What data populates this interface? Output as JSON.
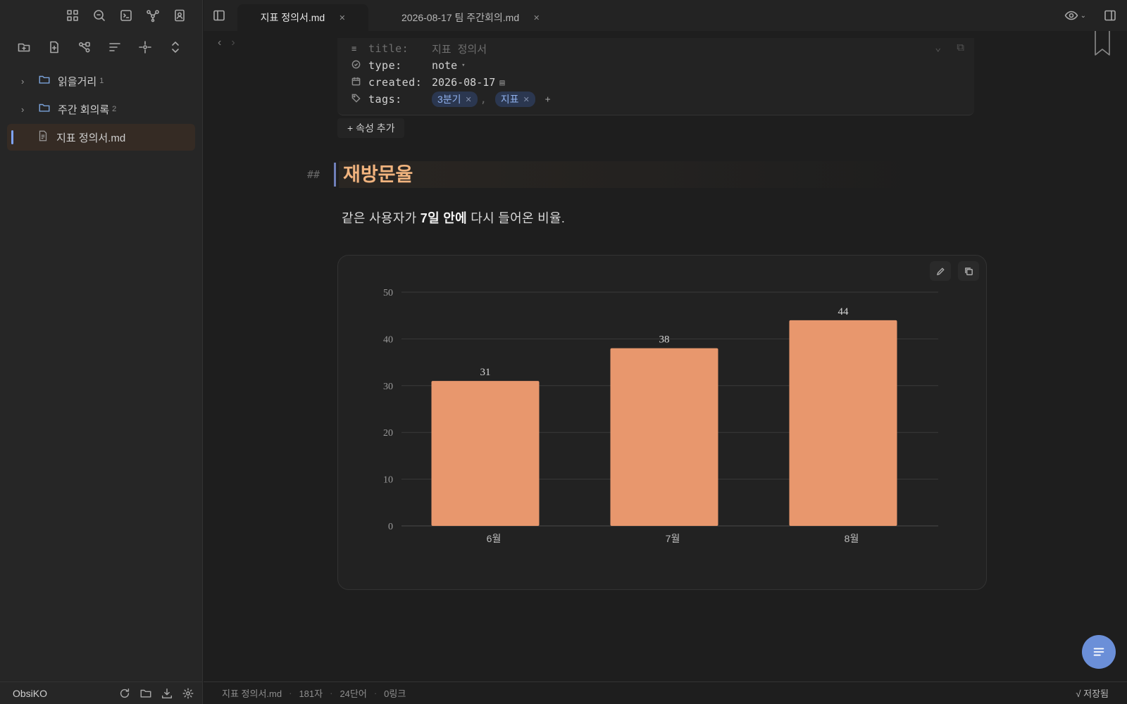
{
  "sidebar": {
    "top_icons": [
      "grid-icon",
      "search-icon",
      "terminal-icon",
      "graph-icon",
      "contact-icon"
    ],
    "action_icons": [
      "new-folder-icon",
      "new-file-icon",
      "share-icon",
      "sort-icon",
      "locate-icon",
      "expand-collapse-icon"
    ],
    "tree": [
      {
        "label": "읽을거리",
        "count": "1",
        "type": "folder"
      },
      {
        "label": "주간 회의록",
        "count": "2",
        "type": "folder"
      },
      {
        "label": "지표 정의서.md",
        "count": "",
        "type": "file",
        "active": true
      }
    ],
    "vault_name": "ObsiKO"
  },
  "tabs": [
    {
      "label": "지표 정의서.md",
      "active": true
    },
    {
      "label": "2026-08-17 팀 주간회의.md",
      "active": false
    }
  ],
  "properties": {
    "title_key": "title:",
    "title_value": "지표 정의서",
    "type_key": "type:",
    "type_value": "note",
    "created_key": "created:",
    "created_value": "2026-08-17",
    "tags_key": "tags:",
    "tags": [
      "3분기",
      "지표"
    ],
    "tag_separator": ",",
    "tag_add": "+",
    "add_property_label": "+ 속성 추가"
  },
  "document": {
    "heading_marker": "##",
    "heading": "재방문율",
    "para_prefix": "같은 사용자가 ",
    "para_bold": "7일 안에",
    "para_suffix": " 다시 들어온 비율."
  },
  "chart_data": {
    "type": "bar",
    "categories": [
      "6월",
      "7월",
      "8월"
    ],
    "values": [
      31,
      38,
      44
    ],
    "ylim": [
      0,
      50
    ],
    "yticks": [
      0,
      10,
      20,
      30,
      40,
      50
    ],
    "grid": true,
    "bar_color": "#e8976d"
  },
  "statusbar": {
    "file": "지표 정의서.md",
    "chars": "181자",
    "words": "24단어",
    "links": "0링크",
    "saved": "√ 저장됨"
  },
  "colors": {
    "accent": "#7ea3f5",
    "heading": "#f0b37e",
    "fab": "#6b8fd8"
  }
}
